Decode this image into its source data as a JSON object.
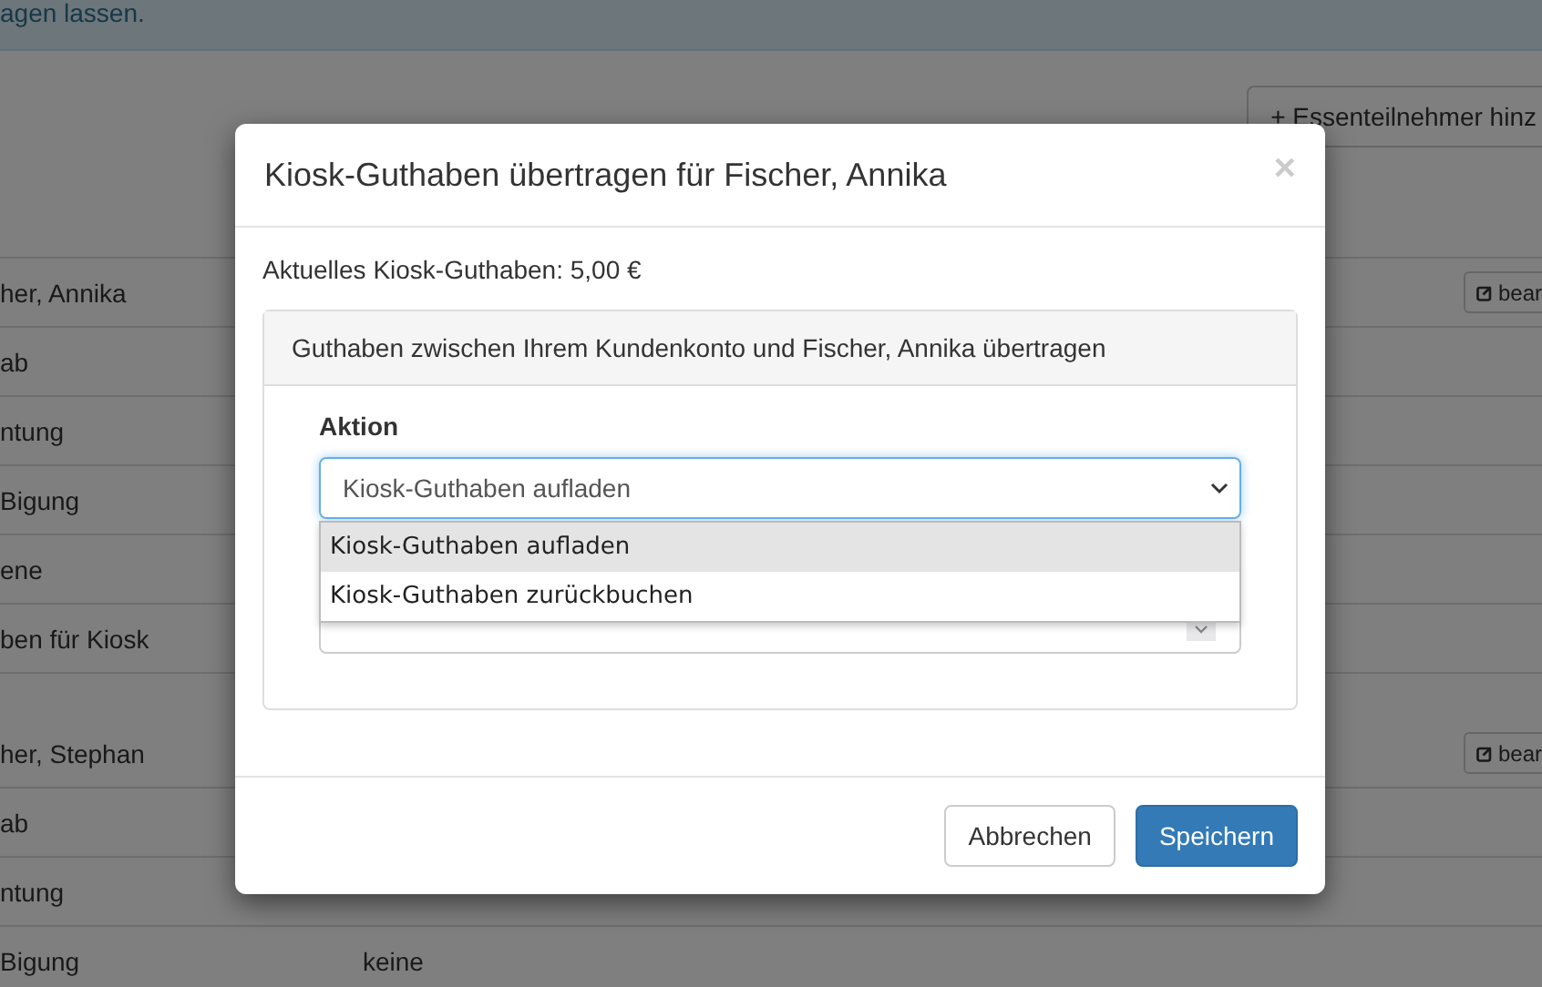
{
  "banner": {
    "text": "agen lassen."
  },
  "toolbar": {
    "add_button": "+ Essenteilnehmer hinz"
  },
  "groups": [
    {
      "rows": [
        {
          "label": "her, Annika",
          "edit_button": "bear"
        },
        {
          "label": "ab"
        },
        {
          "label": "ntung"
        },
        {
          "label": "Bigung"
        },
        {
          "label": "ene"
        },
        {
          "label": "ben für Kiosk"
        }
      ]
    },
    {
      "rows": [
        {
          "label": "her, Stephan",
          "edit_button": "bear"
        },
        {
          "label": "ab"
        },
        {
          "label": "ntung"
        },
        {
          "label": "Bigung",
          "value": "keine"
        }
      ]
    }
  ],
  "modal": {
    "title": "Kiosk-Guthaben übertragen für Fischer, Annika",
    "close": "×",
    "balance_text": "Aktuelles Kiosk-Guthaben: 5,00 €",
    "panel_heading": "Guthaben zwischen Ihrem Kundenkonto und Fischer, Annika übertragen",
    "action_label": "Aktion",
    "select": {
      "value": "Kiosk-Guthaben aufladen",
      "expanded": true,
      "options": [
        {
          "label": "Kiosk-Guthaben aufladen",
          "selected": true
        },
        {
          "label": "Kiosk-Guthaben zurückbuchen",
          "selected": false
        }
      ]
    },
    "buttons": [
      {
        "label": "Abbrechen",
        "kind": "default"
      },
      {
        "label": "Speichern",
        "kind": "primary"
      }
    ]
  }
}
